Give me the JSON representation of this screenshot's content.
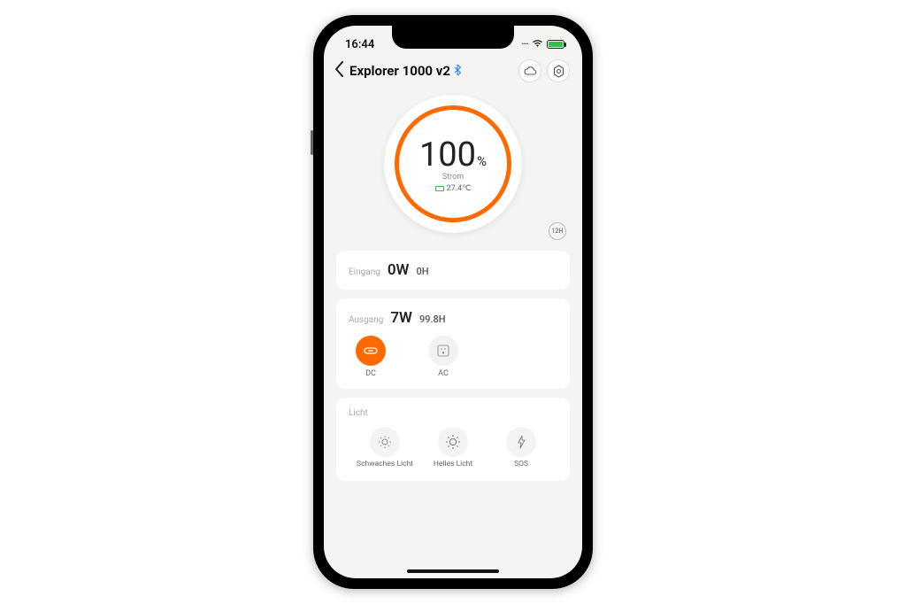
{
  "status": {
    "time": "16:44"
  },
  "header": {
    "title": "Explorer 1000 v2"
  },
  "gauge": {
    "value": "100",
    "percent_sign": "%",
    "label": "Strom",
    "temperature": "27.4℃",
    "badge": "12H"
  },
  "input": {
    "label": "Eingang",
    "power": "0W",
    "hours": "0H"
  },
  "output": {
    "label": "Ausgang",
    "power": "7W",
    "hours": "99.8H",
    "ports": [
      {
        "label": "DC",
        "on": true
      },
      {
        "label": "AC",
        "on": false
      }
    ]
  },
  "light": {
    "label": "Licht",
    "modes": [
      {
        "label": "Schwaches Licht"
      },
      {
        "label": "Helles Licht"
      },
      {
        "label": "SOS"
      }
    ]
  }
}
